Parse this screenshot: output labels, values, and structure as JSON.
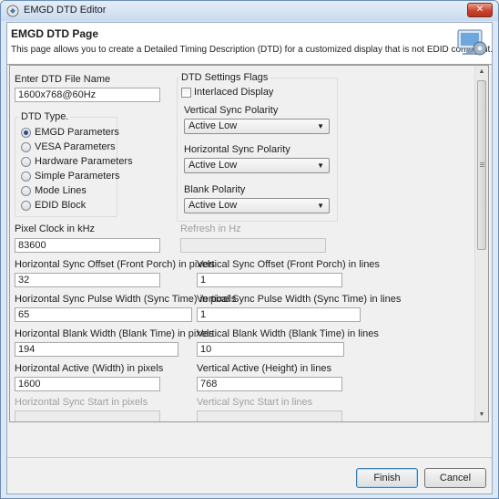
{
  "window": {
    "title": "EMGD DTD Editor",
    "close_glyph": "✕"
  },
  "header": {
    "title": "EMGD DTD Page",
    "description": "This page allows you to create a Detailed Timing Description (DTD) for a customized display that is not EDID compliant."
  },
  "form": {
    "file_name_label": "Enter DTD File Name",
    "file_name_value": "1600x768@60Hz",
    "dtd_type": {
      "label": "DTD Type.",
      "options": [
        "EMGD Parameters",
        "VESA Parameters",
        "Hardware Parameters",
        "Simple Parameters",
        "Mode Lines",
        "EDID Block"
      ],
      "selected": "EMGD Parameters"
    },
    "flags": {
      "label": "DTD Settings Flags",
      "interlaced_label": "Interlaced Display",
      "interlaced_checked": false,
      "vsync_polarity_label": "Vertical Sync Polarity",
      "vsync_polarity_value": "Active Low",
      "hsync_polarity_label": "Horizontal Sync Polarity",
      "hsync_polarity_value": "Active Low",
      "blank_polarity_label": "Blank Polarity",
      "blank_polarity_value": "Active Low"
    },
    "pixel_clock_label": "Pixel Clock in kHz",
    "pixel_clock_value": "83600",
    "refresh_label": "Refresh in Hz",
    "refresh_value": "",
    "h_sync_offset_label": "Horizontal Sync Offset (Front Porch) in pixels",
    "h_sync_offset_value": "32",
    "v_sync_offset_label": "Vertical Sync Offset (Front Porch) in lines",
    "v_sync_offset_value": "1",
    "h_sync_pulse_label": "Horizontal Sync Pulse Width (Sync Time) in pixels",
    "h_sync_pulse_value": "65",
    "v_sync_pulse_label": "Vertical Sync Pulse Width (Sync Time) in lines",
    "v_sync_pulse_value": "1",
    "h_blank_label": "Horizontal Blank Width (Blank Time) in pixels",
    "h_blank_value": "194",
    "v_blank_label": "Vertical Blank Width (Blank Time) in lines",
    "v_blank_value": "10",
    "h_active_label": "Horizontal Active (Width) in pixels",
    "h_active_value": "1600",
    "v_active_label": "Vertical Active (Height) in lines",
    "v_active_value": "768",
    "h_sync_start_label": "Horizontal Sync Start in pixels",
    "h_sync_start_value": "",
    "v_sync_start_label": "Vertical Sync Start in lines",
    "v_sync_start_value": ""
  },
  "buttons": {
    "finish": "Finish",
    "cancel": "Cancel"
  },
  "icons": {
    "app": "app-window-icon",
    "wizard": "wizard-banner-icon",
    "combo_arrow": "▼",
    "scroll_up": "▲",
    "scroll_down": "▼"
  }
}
